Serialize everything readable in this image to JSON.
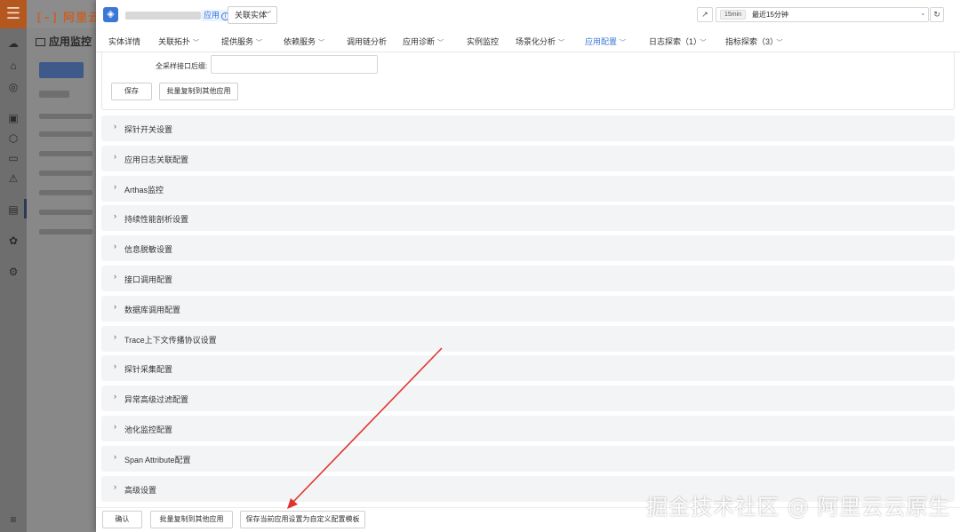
{
  "background": {
    "logo": {
      "bracket": "[-]",
      "text": "阿里云"
    },
    "menu_glyph": "☰",
    "sidebar_title": "应用监控",
    "rail_icons": [
      "cloud-icon",
      "home-icon",
      "globe-icon",
      "scan-icon",
      "cube-icon",
      "monitor-icon",
      "alarm-icon",
      "screen-icon",
      "network-icon",
      "settings-icon",
      "collapse-icon"
    ]
  },
  "header": {
    "entity_tag": "应用",
    "entity_tag_info": "i",
    "linked_entity_label": "关联实体",
    "time_duration": "15min",
    "time_range": "最近15分钟"
  },
  "tabs": [
    {
      "label": "实体详情",
      "has_dropdown": false,
      "active": false
    },
    {
      "label": "关联拓扑",
      "has_dropdown": true,
      "active": false
    },
    {
      "label": "提供服务",
      "has_dropdown": true,
      "active": false
    },
    {
      "label": "依赖服务",
      "has_dropdown": true,
      "active": false
    },
    {
      "label": "调用链分析",
      "has_dropdown": false,
      "active": false
    },
    {
      "label": "应用诊断",
      "has_dropdown": true,
      "active": false
    },
    {
      "label": "实例监控",
      "has_dropdown": false,
      "active": false
    },
    {
      "label": "场景化分析",
      "has_dropdown": true,
      "active": false
    },
    {
      "label": "应用配置",
      "has_dropdown": true,
      "active": true
    },
    {
      "label": "日志探索（1）",
      "has_dropdown": true,
      "active": false
    },
    {
      "label": "指标探索（3）",
      "has_dropdown": true,
      "active": false
    }
  ],
  "open_panel": {
    "field_label": "全采样接口后缀:",
    "field_value": "",
    "save_label": "保存",
    "copy_label": "批量复制到其他应用"
  },
  "sections": [
    "探针开关设置",
    "应用日志关联配置",
    "Arthas监控",
    "持续性能剖析设置",
    "信息脱敏设置",
    "接口调用配置",
    "数据库调用配置",
    "Trace上下文传播协议设置",
    "探针采集配置",
    "异常高级过滤配置",
    "池化监控配置",
    "Span Attribute配置",
    "高级设置"
  ],
  "footer": {
    "confirm_label": "确认",
    "copy_label": "批量复制到其他应用",
    "save_template_label": "保存当前应用设置为自定义配置模板"
  },
  "watermark": "掘金技术社区 @ 阿里云云原生",
  "colors": {
    "accent": "#3a77d6",
    "annotation_arrow": "#e0332b",
    "section_bg": "#f3f4f6",
    "brand_orange": "#b5581f"
  }
}
